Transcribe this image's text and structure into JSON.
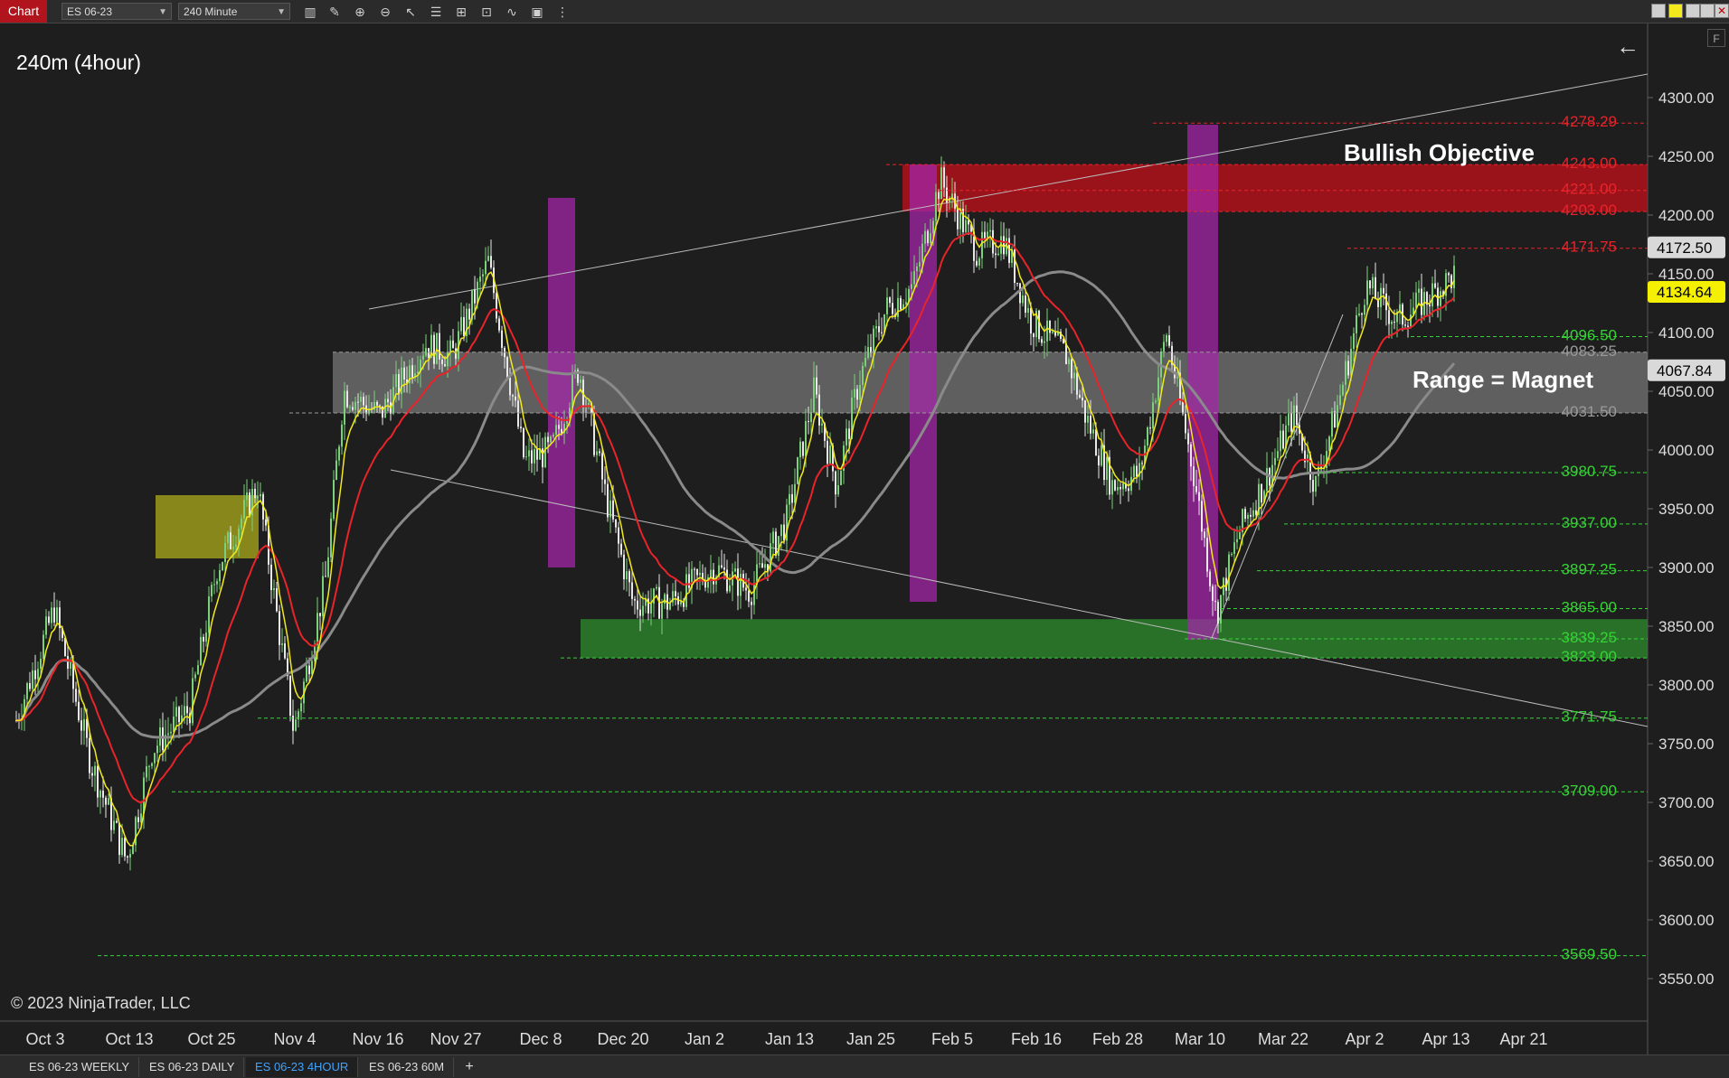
{
  "toolbar": {
    "chart_label": "Chart",
    "instrument": "ES 06-23",
    "interval": "240 Minute",
    "icons": [
      "bar-type-icon",
      "draw-pencil-icon",
      "zoom-in-icon",
      "zoom-out-icon",
      "pointer-icon",
      "properties-icon",
      "templates-icon",
      "chart-trader-icon",
      "indicators-icon",
      "strategies-icon",
      "more-icon"
    ]
  },
  "chart": {
    "title": "240m (4hour)",
    "copyright": "© 2023 NinjaTrader, LLC",
    "annotations": {
      "bullish_objective": "Bullish Objective",
      "range_magnet": "Range = Magnet"
    },
    "price_axis_labels": [
      "4300.00",
      "4250.00",
      "4200.00",
      "4150.00",
      "4100.00",
      "4050.00",
      "4000.00",
      "3950.00",
      "3900.00",
      "3850.00",
      "3800.00",
      "3750.00",
      "3700.00",
      "3650.00",
      "3600.00",
      "3550.00"
    ],
    "date_axis_labels": [
      "Oct 3",
      "Oct 13",
      "Oct 25",
      "Nov 4",
      "Nov 16",
      "Nov 27",
      "Dec 8",
      "Dec 20",
      "Jan 2",
      "Jan 13",
      "Jan 25",
      "Feb 5",
      "Feb 16",
      "Feb 28",
      "Mar 10",
      "Mar 22",
      "Apr 2",
      "Apr 13",
      "Apr 21"
    ],
    "level_lines": [
      {
        "price": 4278.29,
        "label": "4278.29",
        "color": "#e8242a"
      },
      {
        "price": 4243.0,
        "label": "4243.00",
        "color": "#e8242a"
      },
      {
        "price": 4221.0,
        "label": "4221.00",
        "color": "#e8242a"
      },
      {
        "price": 4203.0,
        "label": "4203.00",
        "color": "#e8242a"
      },
      {
        "price": 4171.75,
        "label": "4171.75",
        "color": "#e8242a"
      },
      {
        "price": 4096.5,
        "label": "4096.50",
        "color": "#36d236"
      },
      {
        "price": 4083.25,
        "label": "4083.25",
        "color": "#9a9a9a"
      },
      {
        "price": 4031.5,
        "label": "4031.50",
        "color": "#9a9a9a"
      },
      {
        "price": 3980.75,
        "label": "3980.75",
        "color": "#36d236"
      },
      {
        "price": 3937.0,
        "label": "3937.00",
        "color": "#36d236"
      },
      {
        "price": 3897.25,
        "label": "3897.25",
        "color": "#36d236"
      },
      {
        "price": 3865.0,
        "label": "3865.00",
        "color": "#36d236"
      },
      {
        "price": 3839.25,
        "label": "3839.25",
        "color": "#36d236"
      },
      {
        "price": 3823.0,
        "label": "3823.00",
        "color": "#36d236"
      },
      {
        "price": 3771.75,
        "label": "3771.75",
        "color": "#36d236"
      },
      {
        "price": 3709.0,
        "label": "3709.00",
        "color": "#36d236"
      },
      {
        "price": 3569.5,
        "label": "3569.50",
        "color": "#36d236"
      }
    ],
    "price_markers": [
      {
        "price": 4172.5,
        "label": "4172.50",
        "bg": "#d9d9d9",
        "fg": "#000"
      },
      {
        "price": 4134.64,
        "label": "4134.64",
        "bg": "#f5f000",
        "fg": "#000"
      },
      {
        "price": 4067.84,
        "label": "4067.84",
        "bg": "#d9d9d9",
        "fg": "#000"
      }
    ],
    "colors": {
      "background": "#1e1e1e",
      "candle_up": "#7bd17b",
      "candle_down": "#e8e8e8",
      "ema_fast": "#f2ea1c",
      "ema_slow": "#e8242a",
      "sma_long": "#8a8a8a"
    }
  },
  "tabs": [
    {
      "label": "ES 06-23 WEEKLY",
      "active": false
    },
    {
      "label": "ES 06-23 DAILY",
      "active": false
    },
    {
      "label": "ES 06-23 4HOUR",
      "active": true
    },
    {
      "label": "ES 06-23 60M",
      "active": false
    }
  ],
  "tab_add": "+"
}
